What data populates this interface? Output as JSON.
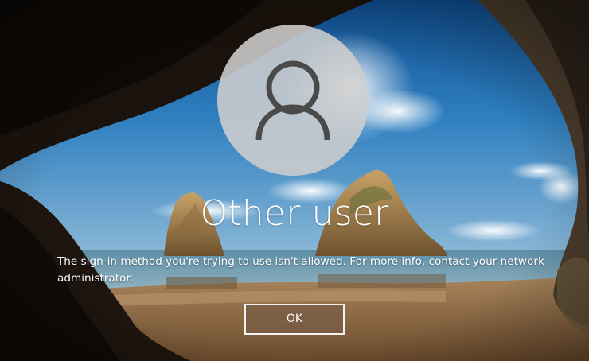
{
  "login": {
    "user_name": "Other user",
    "message": "The sign-in method you're trying to use isn't allowed. For more info, contact your network administrator.",
    "ok_label": "OK"
  },
  "icons": {
    "avatar": "user-silhouette-icon"
  },
  "colors": {
    "avatar_circle": "#cecece",
    "avatar_glyph": "#4a4a4a",
    "text": "#ffffff",
    "button_border": "#f2f2f2",
    "button_fill": "#785c44"
  }
}
